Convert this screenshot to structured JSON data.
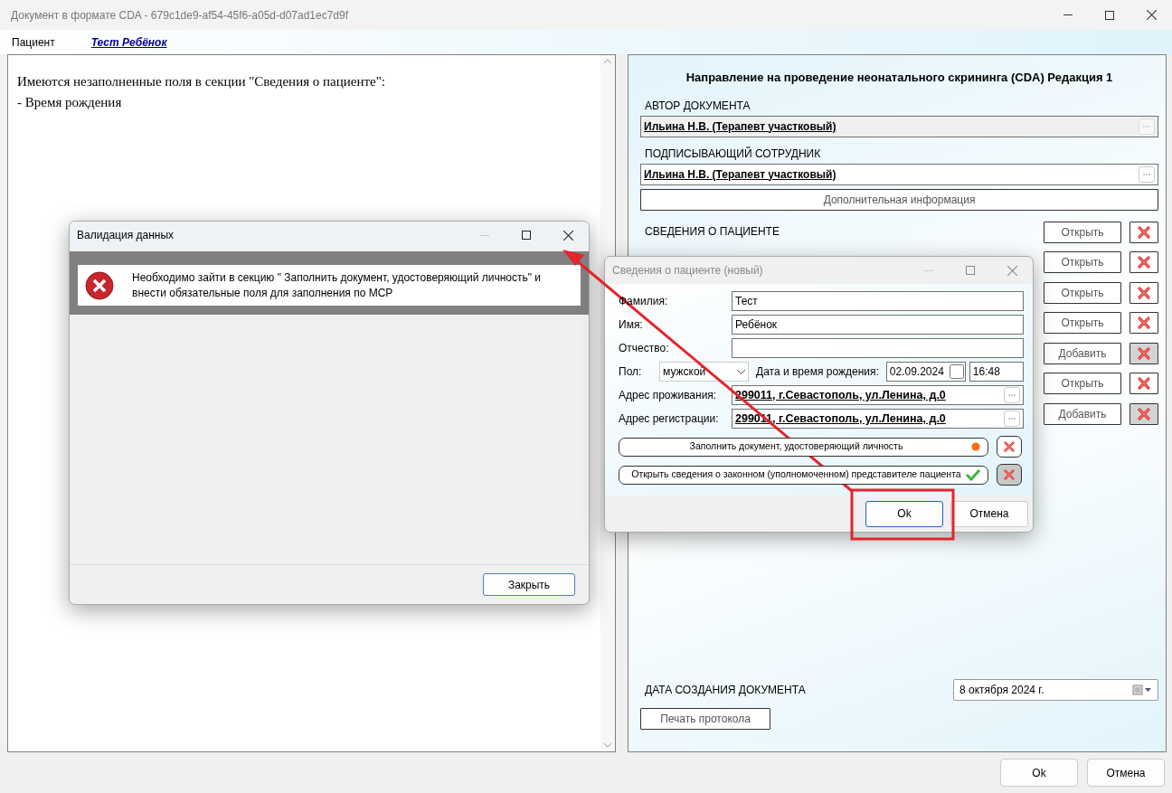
{
  "window": {
    "title": "Документ в формате CDA - 679c1de9-af54-45f6-a05d-d07ad1ec7d9f"
  },
  "patient_bar": {
    "label": "Пациент",
    "name": "Тест Ребёнок"
  },
  "messages": [
    "Имеются незаполненные поля в секции \"Сведения о пациенте\":",
    "- Время рождения"
  ],
  "form": {
    "title": "Направление на проведение неонатального скрининга (CDA) Редакция 1",
    "author": {
      "label": "АВТОР ДОКУМЕНТА",
      "value": "Ильина Н.В. (Терапевт участковый)",
      "disabled": true
    },
    "signer": {
      "label": "ПОДПИСЫВАЮЩИЙ СОТРУДНИК",
      "value": "Ильина Н.В. (Терапевт участковый)",
      "disabled": false
    },
    "extra_button": "Дополнительная информация",
    "sections": [
      {
        "label": "СВЕДЕНИЯ О ПАЦИЕНТЕ",
        "action": "Открыть",
        "delete_disabled": false
      },
      {
        "action": "Открыть",
        "delete_disabled": false
      },
      {
        "action": "Открыть",
        "delete_disabled": false
      },
      {
        "action": "Открыть",
        "delete_disabled": false
      },
      {
        "action": "Добавить",
        "delete_disabled": true
      },
      {
        "action": "Открыть",
        "delete_disabled": false
      },
      {
        "action": "Добавить",
        "delete_disabled": true
      }
    ],
    "creation_date": {
      "label": "ДАТА СОЗДАНИЯ ДОКУМЕНТА",
      "value": "8  октября  2024 г."
    },
    "print_button": "Печать протокола"
  },
  "buttons": [
    "Ok",
    "Отмена"
  ],
  "validation_dialog": {
    "title": "Валидация данных",
    "message": "Необходимо зайти в секцию \" Заполнить документ, удостоверяющий личность\"  и внести обязательные поля для заполнения по МСР",
    "close_button": "Закрыть"
  },
  "patient_dialog": {
    "title": "Сведения о пациенте (новый)",
    "fields": [
      {
        "label": "Фамилия:",
        "value": "Тест"
      },
      {
        "label": "Имя:",
        "value": "Ребёнок"
      },
      {
        "label": "Отчество:"
      }
    ],
    "sex": {
      "label": "Пол:",
      "value": "мужской"
    },
    "birth": {
      "label": "Дата и время рождения:",
      "date": "02.09.2024",
      "date_checked": false,
      "time": "16:48"
    },
    "addresses": [
      {
        "label": "Адрес проживания:",
        "value": "299011, г.Севастополь, ул.Ленина, д.0"
      },
      {
        "label": "Адрес регистрации:",
        "value": "299011, г.Севастополь, ул.Ленина, д.0"
      }
    ],
    "actions": [
      {
        "label": "Заполнить документ, удостоверяющий личность",
        "complete": false,
        "delete_disabled": false
      },
      {
        "label": "Открыть сведения о законном (уполномоченном) представителе пациента",
        "complete": true,
        "delete_disabled": true
      }
    ],
    "buttons": [
      {
        "label": "Ok",
        "selected": true
      },
      {
        "label": "Отмена",
        "selected": false
      }
    ]
  }
}
